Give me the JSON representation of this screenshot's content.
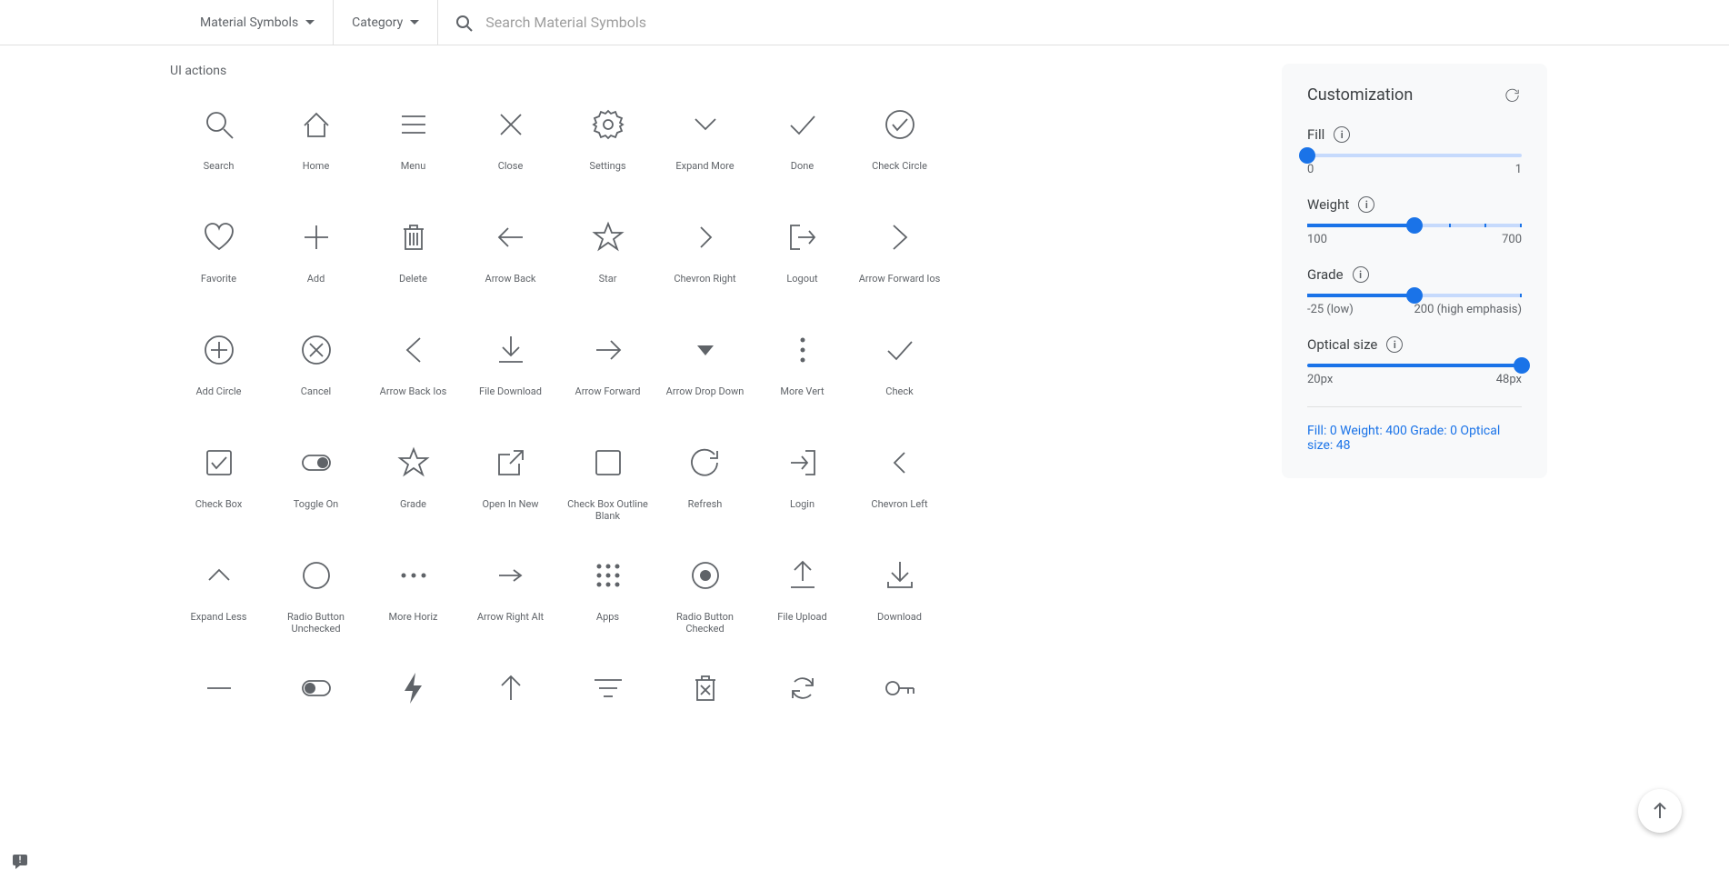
{
  "header": {
    "filter1": "Material Symbols",
    "filter2": "Category",
    "search_placeholder": "Search Material Symbols"
  },
  "section_title": "UI actions",
  "icons": [
    {
      "name": "Search",
      "key": "search"
    },
    {
      "name": "Home",
      "key": "home"
    },
    {
      "name": "Menu",
      "key": "menu"
    },
    {
      "name": "Close",
      "key": "close"
    },
    {
      "name": "Settings",
      "key": "settings"
    },
    {
      "name": "Expand More",
      "key": "expand_more"
    },
    {
      "name": "Done",
      "key": "done"
    },
    {
      "name": "Check Circle",
      "key": "check_circle"
    },
    {
      "name": "Favorite",
      "key": "favorite"
    },
    {
      "name": "Add",
      "key": "add"
    },
    {
      "name": "Delete",
      "key": "delete"
    },
    {
      "name": "Arrow Back",
      "key": "arrow_back"
    },
    {
      "name": "Star",
      "key": "star"
    },
    {
      "name": "Chevron Right",
      "key": "chevron_right"
    },
    {
      "name": "Logout",
      "key": "logout"
    },
    {
      "name": "Arrow Forward Ios",
      "key": "arrow_forward_ios"
    },
    {
      "name": "Add Circle",
      "key": "add_circle"
    },
    {
      "name": "Cancel",
      "key": "cancel"
    },
    {
      "name": "Arrow Back Ios",
      "key": "arrow_back_ios"
    },
    {
      "name": "File Download",
      "key": "file_download"
    },
    {
      "name": "Arrow Forward",
      "key": "arrow_forward"
    },
    {
      "name": "Arrow Drop Down",
      "key": "arrow_drop_down"
    },
    {
      "name": "More Vert",
      "key": "more_vert"
    },
    {
      "name": "Check",
      "key": "check"
    },
    {
      "name": "Check Box",
      "key": "check_box"
    },
    {
      "name": "Toggle On",
      "key": "toggle_on"
    },
    {
      "name": "Grade",
      "key": "grade"
    },
    {
      "name": "Open In New",
      "key": "open_in_new"
    },
    {
      "name": "Check Box Outline Blank",
      "key": "check_box_outline_blank"
    },
    {
      "name": "Refresh",
      "key": "refresh"
    },
    {
      "name": "Login",
      "key": "login"
    },
    {
      "name": "Chevron Left",
      "key": "chevron_left"
    },
    {
      "name": "Expand Less",
      "key": "expand_less"
    },
    {
      "name": "Radio Button Unchecked",
      "key": "radio_button_unchecked"
    },
    {
      "name": "More Horiz",
      "key": "more_horiz"
    },
    {
      "name": "Arrow Right Alt",
      "key": "arrow_right_alt"
    },
    {
      "name": "Apps",
      "key": "apps"
    },
    {
      "name": "Radio Button Checked",
      "key": "radio_button_checked"
    },
    {
      "name": "File Upload",
      "key": "file_upload"
    },
    {
      "name": "Download",
      "key": "download"
    },
    {
      "name": "",
      "key": "remove"
    },
    {
      "name": "",
      "key": "toggle_off"
    },
    {
      "name": "",
      "key": "bolt"
    },
    {
      "name": "",
      "key": "arrow_upward"
    },
    {
      "name": "",
      "key": "filter_list"
    },
    {
      "name": "",
      "key": "delete_forever"
    },
    {
      "name": "",
      "key": "autorenew"
    },
    {
      "name": "",
      "key": "key"
    }
  ],
  "customization": {
    "title": "Customization",
    "fill": {
      "label": "Fill",
      "min": "0",
      "max": "1",
      "value": 0
    },
    "weight": {
      "label": "Weight",
      "min": "100",
      "max": "700",
      "value": 400
    },
    "grade": {
      "label": "Grade",
      "min": "-25 (low)",
      "max": "200 (high emphasis)",
      "value": 0
    },
    "optical_size": {
      "label": "Optical size",
      "min": "20px",
      "max": "48px",
      "value": 48
    },
    "summary": "Fill: 0 Weight: 400 Grade: 0 Optical size: 48"
  }
}
